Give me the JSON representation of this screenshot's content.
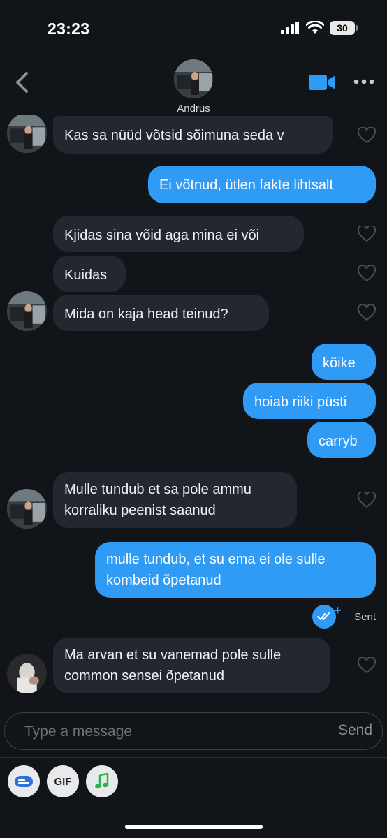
{
  "status": {
    "time": "23:23",
    "battery": "30"
  },
  "header": {
    "contact_name": "Andrus"
  },
  "messages": {
    "m1": "Kas sa nüüd võtsid sõimuna seda v",
    "m2": "Ei võtnud, ütlen fakte lihtsalt",
    "m3": "Kjidas sina võid aga mina ei või",
    "m4": "Kuidas",
    "m5": "Mida on kaja head teinud?",
    "m6": "kõike",
    "m7": "hoiab riiki püsti",
    "m8": "carryb",
    "m9_line1": "Mulle tundub et sa pole ammu",
    "m9_line2": "korraliku peenist saanud",
    "m10_line1": "mulle tundub, et su ema ei ole sulle",
    "m10_line2": "kombeid õpetanud",
    "m11_line1": "Ma arvan et su vanemad pole sulle",
    "m11_line2": "common sensei õpetanud"
  },
  "receipt": {
    "label": "Sent"
  },
  "composer": {
    "placeholder": "Type a message",
    "send_label": "Send"
  },
  "toolbar": {
    "gif_label": "GIF"
  },
  "colors": {
    "background": "#111418",
    "incoming": "#23272f",
    "outgoing": "#2f9bf5",
    "accent": "#2f9bf5"
  }
}
